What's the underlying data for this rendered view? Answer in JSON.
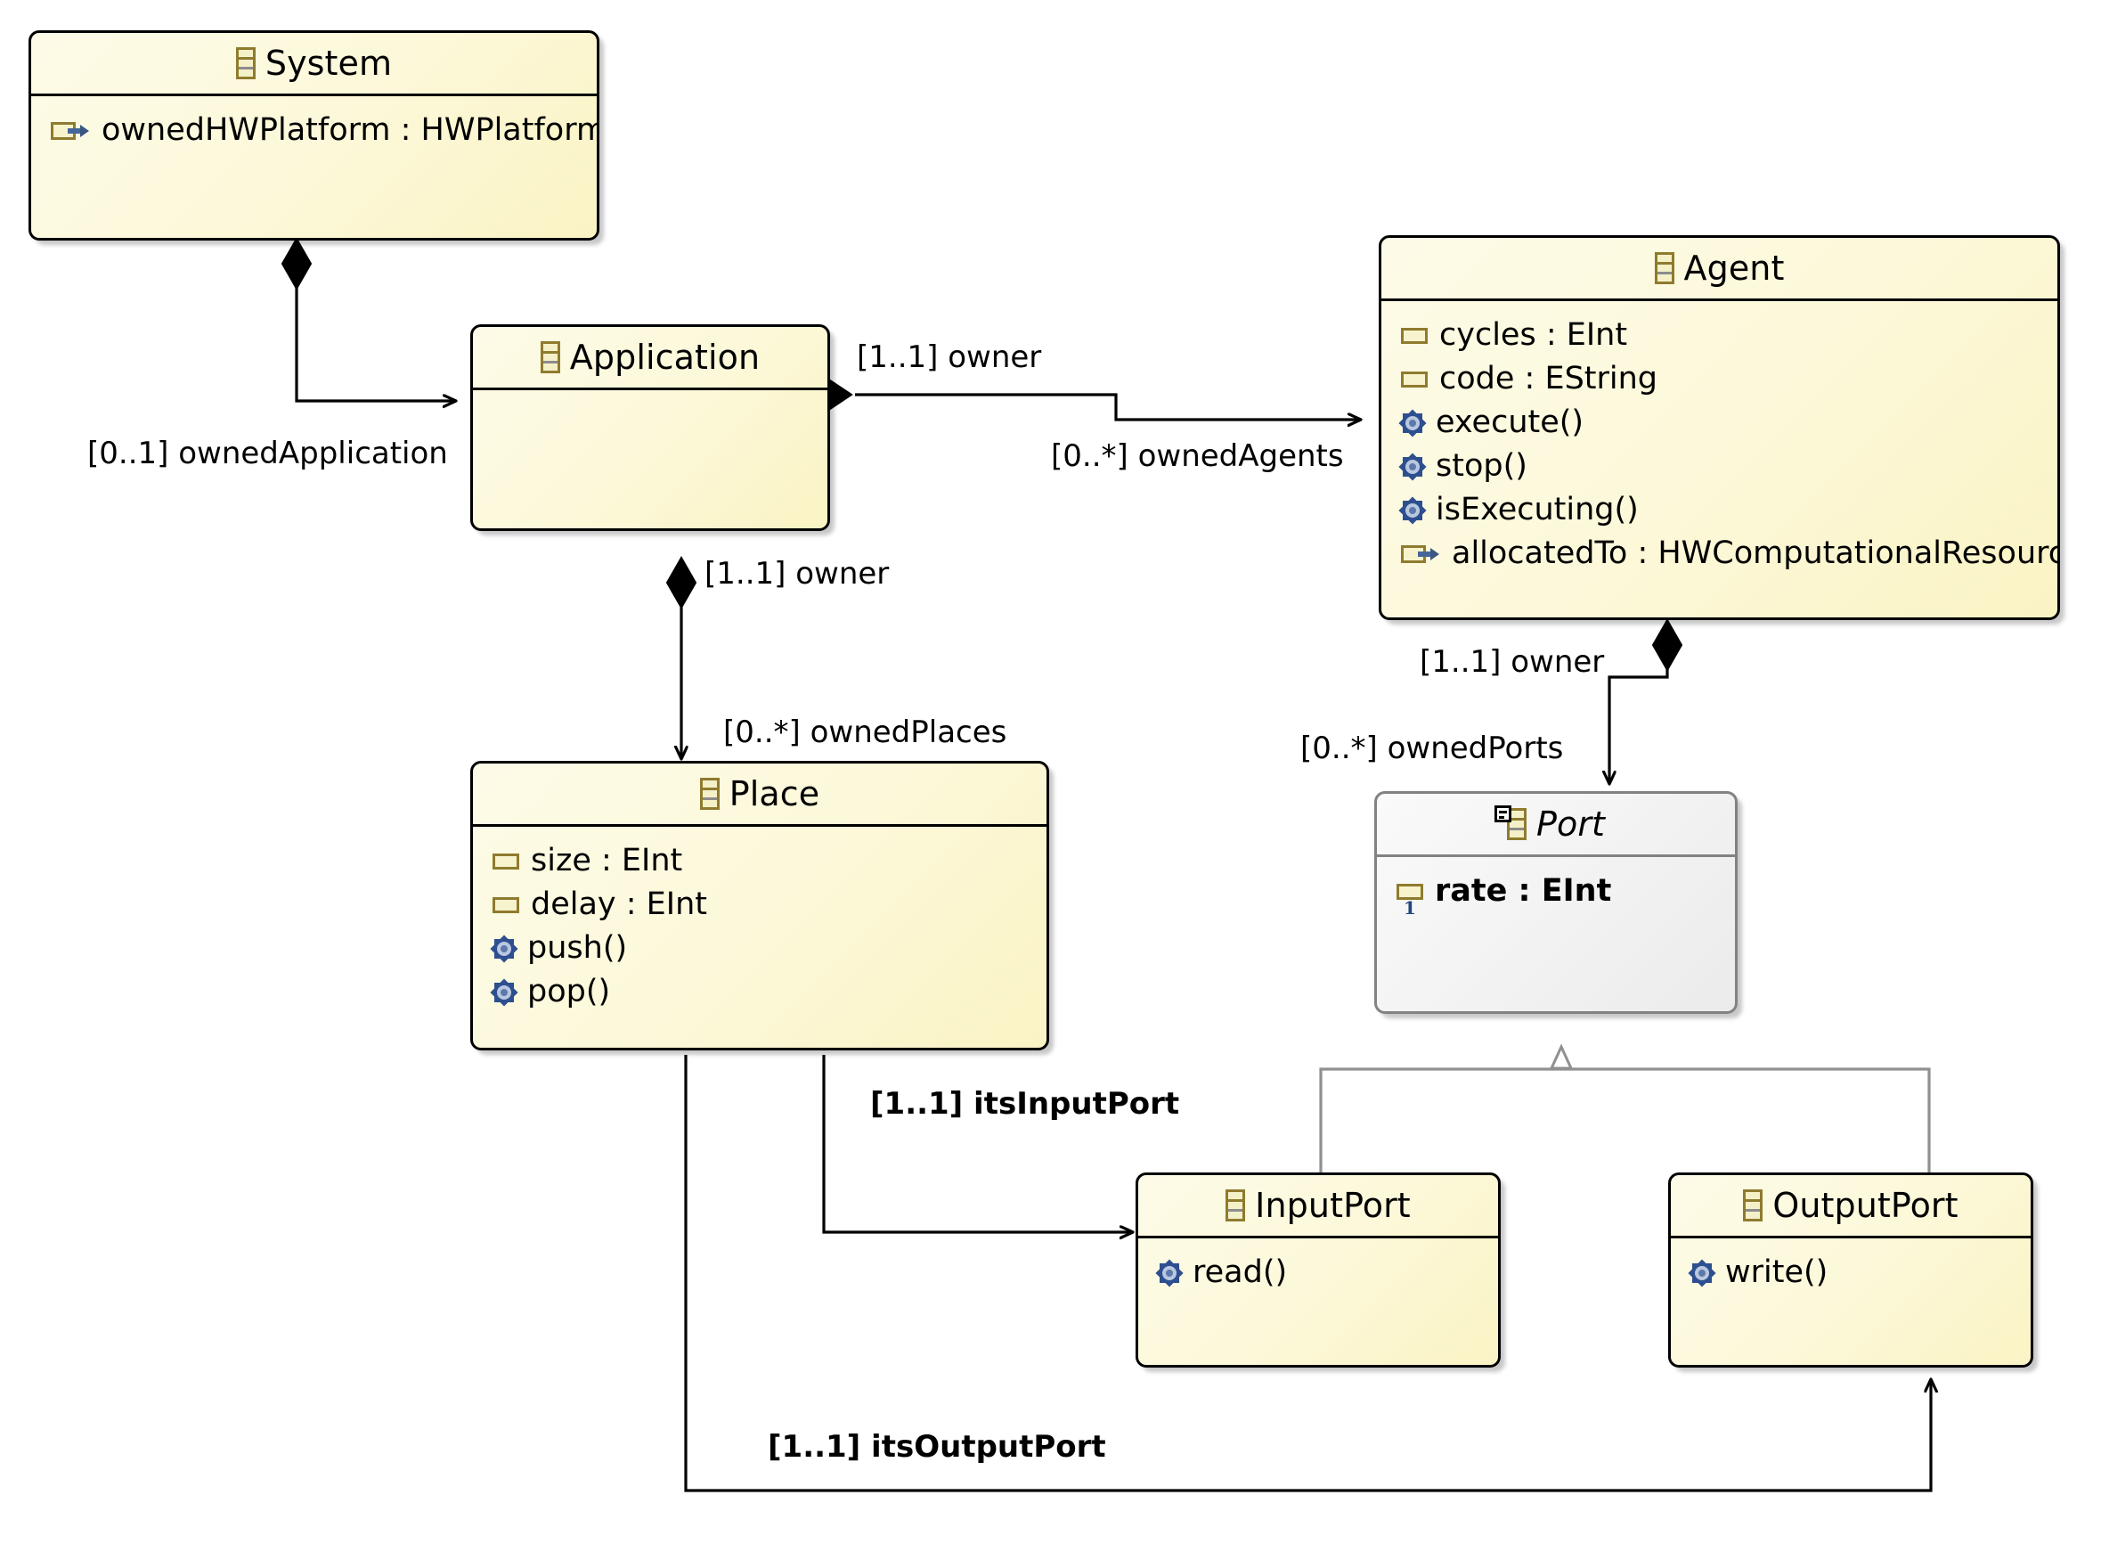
{
  "diagram": {
    "kind": "uml-class-diagram",
    "colors": {
      "class_fill": "#fdfbe8",
      "class_border": "#000000",
      "abstract_fill": "#f2f2f2",
      "abstract_border": "#828282",
      "icon_gold": "#8f7b2e",
      "icon_blue": "#2e4f8f",
      "edge": "#000000",
      "inherit_edge": "#808080"
    }
  },
  "classes": [
    {
      "id": "system",
      "name": "System",
      "abstract": false,
      "icon": "class-icon",
      "features": [
        {
          "kind": "reference",
          "icon": "reference-icon",
          "text": "ownedHWPlatform : HWPlatform",
          "bold": false
        }
      ]
    },
    {
      "id": "application",
      "name": "Application",
      "abstract": false,
      "icon": "class-icon",
      "features": []
    },
    {
      "id": "agent",
      "name": "Agent",
      "abstract": false,
      "icon": "class-icon",
      "features": [
        {
          "kind": "attribute",
          "icon": "attribute-icon",
          "text": "cycles : EInt",
          "bold": false
        },
        {
          "kind": "attribute",
          "icon": "attribute-icon",
          "text": "code : EString",
          "bold": false
        },
        {
          "kind": "operation",
          "icon": "operation-icon",
          "text": "execute()",
          "bold": false
        },
        {
          "kind": "operation",
          "icon": "operation-icon",
          "text": "stop()",
          "bold": false
        },
        {
          "kind": "operation",
          "icon": "operation-icon",
          "text": "isExecuting()",
          "bold": false
        },
        {
          "kind": "reference",
          "icon": "reference-icon",
          "text": "allocatedTo : HWComputationalResource",
          "bold": false
        }
      ]
    },
    {
      "id": "place",
      "name": "Place",
      "abstract": false,
      "icon": "class-icon",
      "features": [
        {
          "kind": "attribute",
          "icon": "attribute-icon",
          "text": "size : EInt",
          "bold": false
        },
        {
          "kind": "attribute",
          "icon": "attribute-icon",
          "text": "delay : EInt",
          "bold": false
        },
        {
          "kind": "operation",
          "icon": "operation-icon",
          "text": "push()",
          "bold": false
        },
        {
          "kind": "operation",
          "icon": "operation-icon",
          "text": "pop()",
          "bold": false
        }
      ]
    },
    {
      "id": "port",
      "name": "Port",
      "abstract": true,
      "icon": "abstract-class-icon",
      "features": [
        {
          "kind": "attribute",
          "icon": "attribute-icon-multiplicity",
          "text": "rate : EInt",
          "bold": true,
          "multiplicity": "1"
        }
      ]
    },
    {
      "id": "inputport",
      "name": "InputPort",
      "abstract": false,
      "icon": "class-icon",
      "features": [
        {
          "kind": "operation",
          "icon": "operation-icon",
          "text": "read()",
          "bold": false
        }
      ]
    },
    {
      "id": "outputport",
      "name": "OutputPort",
      "abstract": false,
      "icon": "class-icon",
      "features": [
        {
          "kind": "operation",
          "icon": "operation-icon",
          "text": "write()",
          "bold": false
        }
      ]
    }
  ],
  "edge_labels": {
    "owned_application": "[0..1] ownedApplication",
    "owner_agent": "[1..1] owner",
    "owned_agents": "[0..*] ownedAgents",
    "owner_place": "[1..1] owner",
    "owned_places": "[0..*] ownedPlaces",
    "owner_port": "[1..1] owner",
    "owned_ports": "[0..*] ownedPorts",
    "its_input_port": "[1..1] itsInputPort",
    "its_output_port": "[1..1] itsOutputPort"
  },
  "relationships": [
    {
      "id": "system-application",
      "type": "composition",
      "from": "System",
      "to": "Application",
      "source_label": "[0..1] ownedApplication"
    },
    {
      "id": "application-agent",
      "type": "composition",
      "from": "Application",
      "to": "Agent",
      "source_label": "[1..1] owner",
      "target_label": "[0..*] ownedAgents"
    },
    {
      "id": "application-place",
      "type": "composition",
      "from": "Application",
      "to": "Place",
      "source_label": "[1..1] owner",
      "target_label": "[0..*] ownedPlaces"
    },
    {
      "id": "agent-port",
      "type": "composition",
      "from": "Agent",
      "to": "Port",
      "source_label": "[1..1] owner",
      "target_label": "[0..*] ownedPorts"
    },
    {
      "id": "place-inputport",
      "type": "association",
      "from": "Place",
      "to": "InputPort",
      "target_label": "[1..1] itsInputPort"
    },
    {
      "id": "place-outputport",
      "type": "association",
      "from": "Place",
      "to": "OutputPort",
      "target_label": "[1..1] itsOutputPort"
    },
    {
      "id": "inputport-port",
      "type": "generalization",
      "from": "InputPort",
      "to": "Port"
    },
    {
      "id": "outputport-port",
      "type": "generalization",
      "from": "OutputPort",
      "to": "Port"
    }
  ]
}
